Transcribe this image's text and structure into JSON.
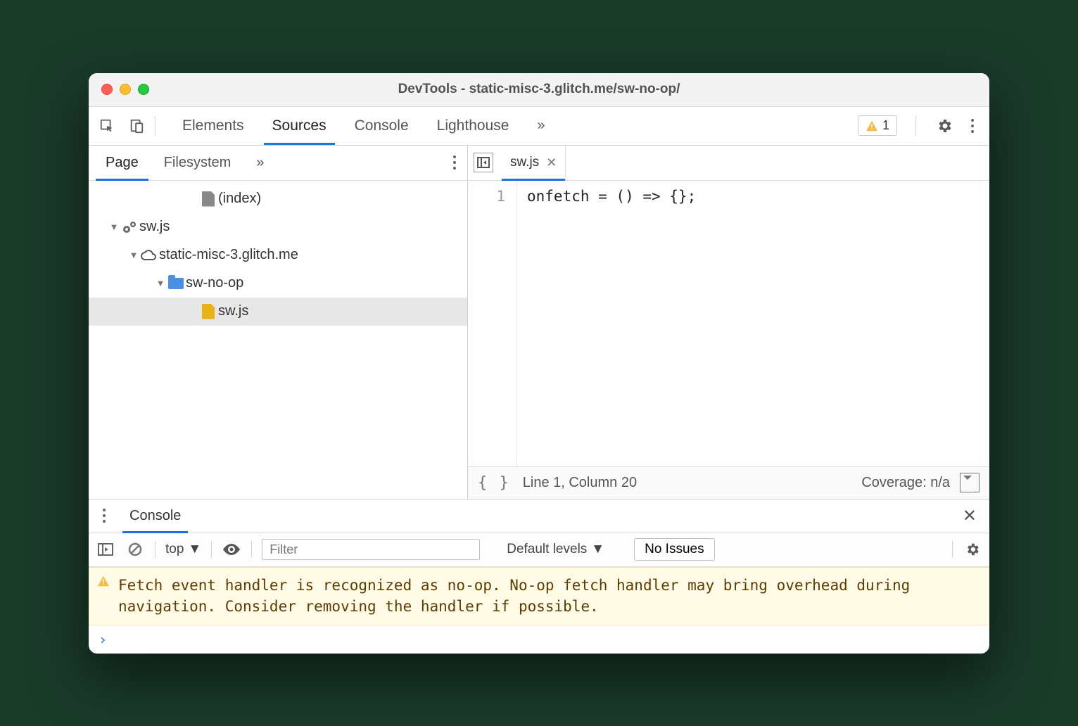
{
  "window": {
    "title": "DevTools - static-misc-3.glitch.me/sw-no-op/"
  },
  "toolbar": {
    "tabs": [
      "Elements",
      "Sources",
      "Console",
      "Lighthouse"
    ],
    "active_tab": "Sources",
    "warning_count": "1"
  },
  "sources": {
    "left_tabs": [
      "Page",
      "Filesystem"
    ],
    "left_active": "Page",
    "tree": {
      "index_label": "(index)",
      "sw_worker": "sw.js",
      "domain": "static-misc-3.glitch.me",
      "folder": "sw-no-op",
      "file": "sw.js"
    },
    "open_file": "sw.js",
    "code_line_no": "1",
    "code_line": "onfetch = () => {};",
    "status_position": "Line 1, Column 20",
    "status_coverage": "Coverage: n/a",
    "pretty_label": "{ }"
  },
  "drawer": {
    "tab": "Console"
  },
  "console": {
    "context": "top",
    "filter_placeholder": "Filter",
    "levels": "Default levels",
    "issues": "No Issues",
    "warning": "Fetch event handler is recognized as no-op. No-op fetch handler may bring overhead during navigation. Consider removing the handler if possible.",
    "prompt": "›"
  }
}
